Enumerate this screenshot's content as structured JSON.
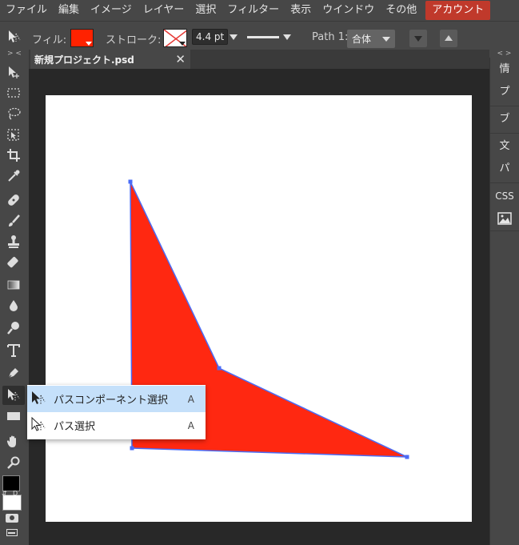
{
  "menubar": {
    "items": [
      "ファイル",
      "編集",
      "イメージ",
      "レイヤー",
      "選択",
      "フィルター",
      "表示",
      "ウインドウ",
      "その他"
    ],
    "account": "アカウント"
  },
  "options": {
    "fill_label": "フィル:",
    "fill_color": "#ff2200",
    "stroke_label": "ストローク:",
    "stroke_width": "4.4 pt",
    "path_label": "Path 1:",
    "path_op": "合体"
  },
  "panel_toggle_left": "> <",
  "panel_toggle_right": "< >",
  "tab": {
    "title": "新規プロジェクト.psd",
    "close": "✕"
  },
  "right_panel": [
    "情",
    "プ",
    "ブ",
    "文",
    "パ",
    "CSS"
  ],
  "tools": [
    "move-tool",
    "marquee-tool",
    "lasso-tool",
    "quick-select-tool",
    "crop-tool",
    "eyedropper-tool",
    "healing-tool",
    "brush-tool",
    "stamp-tool",
    "eraser-tool",
    "gradient-tool",
    "blur-tool",
    "dodge-tool",
    "type-tool",
    "pen-tool",
    "path-select-tool",
    "rectangle-tool",
    "hand-tool",
    "zoom-tool"
  ],
  "colors": {
    "foreground": "#000000",
    "background": "#ffffff",
    "accent": "#c0392b",
    "path_stroke": "#4a6cf7",
    "shape_fill": "#ff2811"
  },
  "context_menu": {
    "items": [
      {
        "label": "パスコンポーネント選択",
        "shortcut": "A"
      },
      {
        "label": "パス選択",
        "shortcut": "A"
      }
    ]
  }
}
